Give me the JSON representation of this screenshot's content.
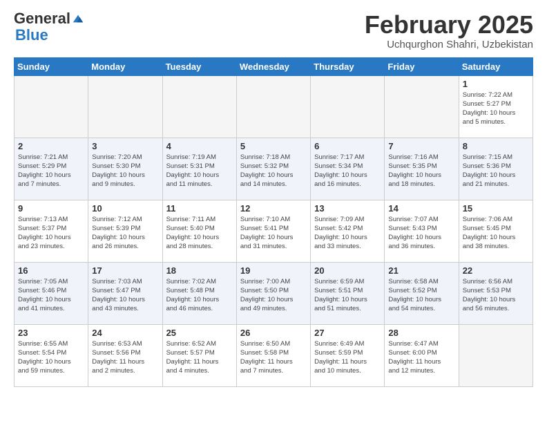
{
  "header": {
    "logo_general": "General",
    "logo_blue": "Blue",
    "month_title": "February 2025",
    "subtitle": "Uchqurghon Shahri, Uzbekistan"
  },
  "weekdays": [
    "Sunday",
    "Monday",
    "Tuesday",
    "Wednesday",
    "Thursday",
    "Friday",
    "Saturday"
  ],
  "weeks": [
    [
      {
        "day": "",
        "info": ""
      },
      {
        "day": "",
        "info": ""
      },
      {
        "day": "",
        "info": ""
      },
      {
        "day": "",
        "info": ""
      },
      {
        "day": "",
        "info": ""
      },
      {
        "day": "",
        "info": ""
      },
      {
        "day": "1",
        "info": "Sunrise: 7:22 AM\nSunset: 5:27 PM\nDaylight: 10 hours\nand 5 minutes."
      }
    ],
    [
      {
        "day": "2",
        "info": "Sunrise: 7:21 AM\nSunset: 5:29 PM\nDaylight: 10 hours\nand 7 minutes."
      },
      {
        "day": "3",
        "info": "Sunrise: 7:20 AM\nSunset: 5:30 PM\nDaylight: 10 hours\nand 9 minutes."
      },
      {
        "day": "4",
        "info": "Sunrise: 7:19 AM\nSunset: 5:31 PM\nDaylight: 10 hours\nand 11 minutes."
      },
      {
        "day": "5",
        "info": "Sunrise: 7:18 AM\nSunset: 5:32 PM\nDaylight: 10 hours\nand 14 minutes."
      },
      {
        "day": "6",
        "info": "Sunrise: 7:17 AM\nSunset: 5:34 PM\nDaylight: 10 hours\nand 16 minutes."
      },
      {
        "day": "7",
        "info": "Sunrise: 7:16 AM\nSunset: 5:35 PM\nDaylight: 10 hours\nand 18 minutes."
      },
      {
        "day": "8",
        "info": "Sunrise: 7:15 AM\nSunset: 5:36 PM\nDaylight: 10 hours\nand 21 minutes."
      }
    ],
    [
      {
        "day": "9",
        "info": "Sunrise: 7:13 AM\nSunset: 5:37 PM\nDaylight: 10 hours\nand 23 minutes."
      },
      {
        "day": "10",
        "info": "Sunrise: 7:12 AM\nSunset: 5:39 PM\nDaylight: 10 hours\nand 26 minutes."
      },
      {
        "day": "11",
        "info": "Sunrise: 7:11 AM\nSunset: 5:40 PM\nDaylight: 10 hours\nand 28 minutes."
      },
      {
        "day": "12",
        "info": "Sunrise: 7:10 AM\nSunset: 5:41 PM\nDaylight: 10 hours\nand 31 minutes."
      },
      {
        "day": "13",
        "info": "Sunrise: 7:09 AM\nSunset: 5:42 PM\nDaylight: 10 hours\nand 33 minutes."
      },
      {
        "day": "14",
        "info": "Sunrise: 7:07 AM\nSunset: 5:43 PM\nDaylight: 10 hours\nand 36 minutes."
      },
      {
        "day": "15",
        "info": "Sunrise: 7:06 AM\nSunset: 5:45 PM\nDaylight: 10 hours\nand 38 minutes."
      }
    ],
    [
      {
        "day": "16",
        "info": "Sunrise: 7:05 AM\nSunset: 5:46 PM\nDaylight: 10 hours\nand 41 minutes."
      },
      {
        "day": "17",
        "info": "Sunrise: 7:03 AM\nSunset: 5:47 PM\nDaylight: 10 hours\nand 43 minutes."
      },
      {
        "day": "18",
        "info": "Sunrise: 7:02 AM\nSunset: 5:48 PM\nDaylight: 10 hours\nand 46 minutes."
      },
      {
        "day": "19",
        "info": "Sunrise: 7:00 AM\nSunset: 5:50 PM\nDaylight: 10 hours\nand 49 minutes."
      },
      {
        "day": "20",
        "info": "Sunrise: 6:59 AM\nSunset: 5:51 PM\nDaylight: 10 hours\nand 51 minutes."
      },
      {
        "day": "21",
        "info": "Sunrise: 6:58 AM\nSunset: 5:52 PM\nDaylight: 10 hours\nand 54 minutes."
      },
      {
        "day": "22",
        "info": "Sunrise: 6:56 AM\nSunset: 5:53 PM\nDaylight: 10 hours\nand 56 minutes."
      }
    ],
    [
      {
        "day": "23",
        "info": "Sunrise: 6:55 AM\nSunset: 5:54 PM\nDaylight: 10 hours\nand 59 minutes."
      },
      {
        "day": "24",
        "info": "Sunrise: 6:53 AM\nSunset: 5:56 PM\nDaylight: 11 hours\nand 2 minutes."
      },
      {
        "day": "25",
        "info": "Sunrise: 6:52 AM\nSunset: 5:57 PM\nDaylight: 11 hours\nand 4 minutes."
      },
      {
        "day": "26",
        "info": "Sunrise: 6:50 AM\nSunset: 5:58 PM\nDaylight: 11 hours\nand 7 minutes."
      },
      {
        "day": "27",
        "info": "Sunrise: 6:49 AM\nSunset: 5:59 PM\nDaylight: 11 hours\nand 10 minutes."
      },
      {
        "day": "28",
        "info": "Sunrise: 6:47 AM\nSunset: 6:00 PM\nDaylight: 11 hours\nand 12 minutes."
      },
      {
        "day": "",
        "info": ""
      }
    ]
  ]
}
